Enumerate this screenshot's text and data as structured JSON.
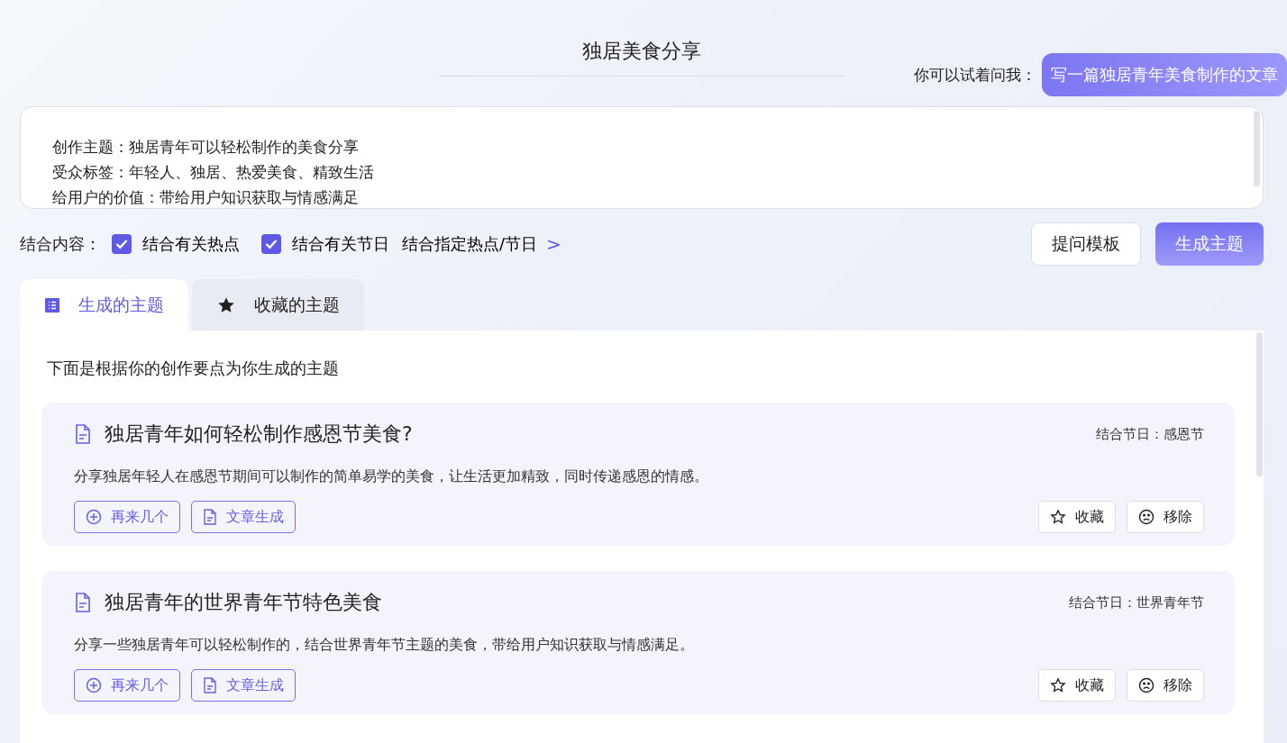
{
  "title": "独居美食分享",
  "suggestion": {
    "label": "你可以试着问我：",
    "chip": "写一篇独居青年美食制作的文章"
  },
  "prompt_field": {
    "lines": [
      "创作主题：独居青年可以轻松制作的美食分享",
      "受众标签：年轻人、独居、热爱美食、精致生活",
      "给用户的价值：带给用户知识获取与情感满足"
    ]
  },
  "options": {
    "label": "结合内容：",
    "checkboxes": [
      {
        "label": "结合有关热点",
        "checked": true
      },
      {
        "label": "结合有关节日",
        "checked": true
      }
    ],
    "link": "结合指定热点/节日",
    "link_icon": ">"
  },
  "buttons": [
    {
      "label": "提问模板",
      "kind": "secondary"
    },
    {
      "label": "生成主题",
      "kind": "primary"
    }
  ],
  "tabs": [
    {
      "label": "生成的主题",
      "selected": true
    },
    {
      "label": "收藏的主题",
      "selected": false
    }
  ],
  "intro": "下面是根据你的创作要点为你生成的主题",
  "topics": [
    {
      "title": "独居青年如何轻松制作感恩节美食?",
      "festival": "结合节日：感恩节",
      "description": "分享独居年轻人在感恩节期间可以制作的简单易学的美食，让生活更加精致，同时传递感恩的情感。",
      "actions": [
        "再来几个",
        "文章生成"
      ],
      "side_actions": [
        "收藏",
        "移除"
      ]
    },
    {
      "title": "独居青年的世界青年节特色美食",
      "festival": "结合节日：世界青年节",
      "description": "分享一些独居青年可以轻松制作的，结合世界青年节主题的美食，带给用户知识获取与情感满足。",
      "actions": [
        "再来几个",
        "文章生成"
      ],
      "side_actions": [
        "收藏",
        "移除"
      ]
    }
  ]
}
